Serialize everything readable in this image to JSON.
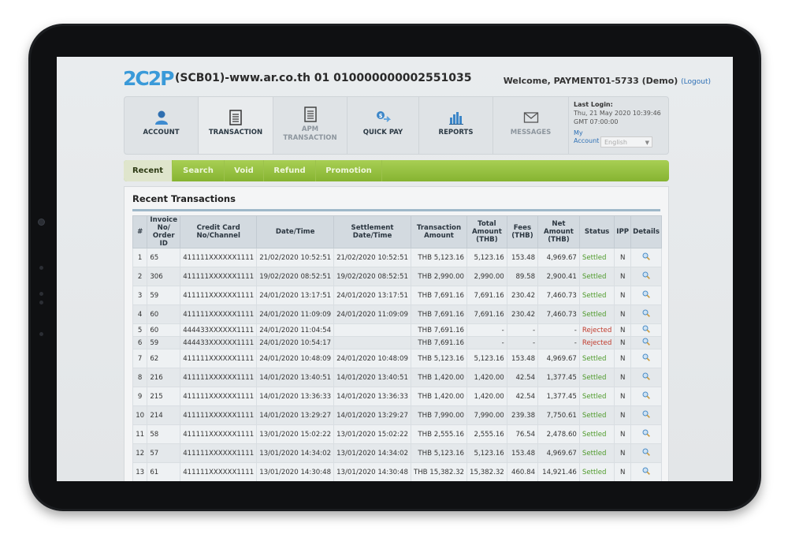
{
  "header": {
    "logo_text": "2C2P",
    "logo_tag": "",
    "merchant_line": "(SCB01)-www.ar.co.th 01 010000000002551035",
    "welcome": "Welcome, PAYMENT01-5733 (Demo)",
    "logout": "(Logout)"
  },
  "nav": [
    {
      "label": "ACCOUNT",
      "icon": "user-icon"
    },
    {
      "label": "TRANSACTION",
      "icon": "document-icon"
    },
    {
      "label": "APM TRANSACTION",
      "icon": "document-icon"
    },
    {
      "label": "QUICK PAY",
      "icon": "quick-pay-icon"
    },
    {
      "label": "REPORTS",
      "icon": "bar-chart-icon"
    },
    {
      "label": "MESSAGES",
      "icon": "envelope-icon"
    }
  ],
  "login": {
    "title": "Last Login:",
    "time1": "Thu, 21 May 2020 10:39:46",
    "time2": "GMT 07:00:00",
    "account_link": "My Account",
    "language": "English"
  },
  "subnav": [
    "Recent",
    "Search",
    "Void",
    "Refund",
    "Promotion"
  ],
  "panel": {
    "title": "Recent Transactions"
  },
  "table": {
    "headers": [
      "#",
      "Invoice No/ Order ID",
      "Credit Card No/Channel",
      "Date/Time",
      "Settlement Date/Time",
      "Transaction Amount",
      "Total Amount (THB)",
      "Fees (THB)",
      "Net Amount (THB)",
      "Status",
      "IPP",
      "Details"
    ],
    "rows": [
      [
        "1",
        "65",
        "411111XXXXXX1111",
        "21/02/2020 10:52:51",
        "21/02/2020 10:52:51",
        "THB 5,123.16",
        "5,123.16",
        "153.48",
        "4,969.67",
        "Settled",
        "N"
      ],
      [
        "2",
        "306",
        "411111XXXXXX1111",
        "19/02/2020 08:52:51",
        "19/02/2020 08:52:51",
        "THB 2,990.00",
        "2,990.00",
        "89.58",
        "2,900.41",
        "Settled",
        "N"
      ],
      [
        "3",
        "59",
        "411111XXXXXX1111",
        "24/01/2020 13:17:51",
        "24/01/2020 13:17:51",
        "THB 7,691.16",
        "7,691.16",
        "230.42",
        "7,460.73",
        "Settled",
        "N"
      ],
      [
        "4",
        "60",
        "411111XXXXXX1111",
        "24/01/2020 11:09:09",
        "24/01/2020 11:09:09",
        "THB 7,691.16",
        "7,691.16",
        "230.42",
        "7,460.73",
        "Settled",
        "N"
      ],
      [
        "5",
        "60",
        "444433XXXXXX1111",
        "24/01/2020 11:04:54",
        "",
        "THB 7,691.16",
        "-",
        "-",
        "-",
        "Rejected",
        "N"
      ],
      [
        "6",
        "59",
        "444433XXXXXX1111",
        "24/01/2020 10:54:17",
        "",
        "THB 7,691.16",
        "-",
        "-",
        "-",
        "Rejected",
        "N"
      ],
      [
        "7",
        "62",
        "411111XXXXXX1111",
        "24/01/2020 10:48:09",
        "24/01/2020 10:48:09",
        "THB 5,123.16",
        "5,123.16",
        "153.48",
        "4,969.67",
        "Settled",
        "N"
      ],
      [
        "8",
        "216",
        "411111XXXXXX1111",
        "14/01/2020 13:40:51",
        "14/01/2020 13:40:51",
        "THB 1,420.00",
        "1,420.00",
        "42.54",
        "1,377.45",
        "Settled",
        "N"
      ],
      [
        "9",
        "215",
        "411111XXXXXX1111",
        "14/01/2020 13:36:33",
        "14/01/2020 13:36:33",
        "THB 1,420.00",
        "1,420.00",
        "42.54",
        "1,377.45",
        "Settled",
        "N"
      ],
      [
        "10",
        "214",
        "411111XXXXXX1111",
        "14/01/2020 13:29:27",
        "14/01/2020 13:29:27",
        "THB 7,990.00",
        "7,990.00",
        "239.38",
        "7,750.61",
        "Settled",
        "N"
      ],
      [
        "11",
        "58",
        "411111XXXXXX1111",
        "13/01/2020 15:02:22",
        "13/01/2020 15:02:22",
        "THB 2,555.16",
        "2,555.16",
        "76.54",
        "2,478.60",
        "Settled",
        "N"
      ],
      [
        "12",
        "57",
        "411111XXXXXX1111",
        "13/01/2020 14:34:02",
        "13/01/2020 14:34:02",
        "THB 5,123.16",
        "5,123.16",
        "153.48",
        "4,969.67",
        "Settled",
        "N"
      ],
      [
        "13",
        "61",
        "411111XXXXXX1111",
        "13/01/2020 14:30:48",
        "13/01/2020 14:30:48",
        "THB 15,382.32",
        "15,382.32",
        "460.84",
        "14,921.46",
        "Settled",
        "N"
      ]
    ]
  },
  "colors": {
    "accent_green": "#8dbb37",
    "settled": "#4e9a2a",
    "rejected": "#c0392b",
    "link": "#2c6fb5"
  }
}
